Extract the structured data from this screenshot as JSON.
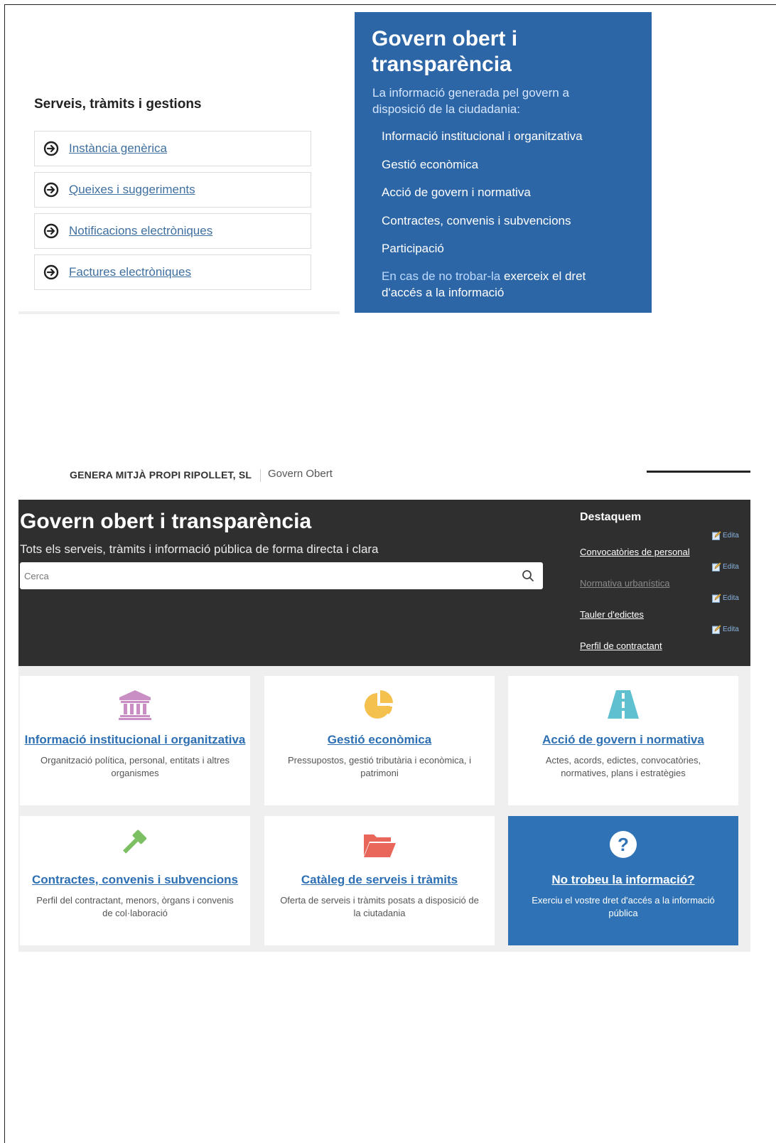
{
  "serveis": {
    "title": "Serveis, tràmits i gestions",
    "items": [
      {
        "label": "Instància genèrica"
      },
      {
        "label": "Queixes i suggeriments"
      },
      {
        "label": "Notificacions electròniques"
      },
      {
        "label": "Factures electròniques"
      }
    ]
  },
  "govern_panel": {
    "title": "Govern obert i transparència",
    "intro": "La informació generada pel govern a disposició de la ciudadania:",
    "links": [
      "Informació institucional i organitzativa",
      "Gestió econòmica",
      "Acció de govern i normativa",
      "Contractes, convenis i subvencions",
      "Participació"
    ],
    "last_link_part1": "En cas de no trobar-la",
    "last_link_part2": " exerceix el dret d'accés a la informació"
  },
  "brand": {
    "name": "GENERA MITJÀ PROPI RIPOLLET, SL",
    "subtitle": "Govern Obert"
  },
  "hero": {
    "title": "Govern obert i transparència",
    "subtitle": "Tots els serveis, tràmits i informació pública de forma directa i clara",
    "search_placeholder": "Cerca"
  },
  "destaquem": {
    "title": "Destaquem",
    "edit_label": "Edita",
    "links": [
      {
        "label": "Convocatòries de personal",
        "dimmed": false
      },
      {
        "label": "Normativa urbanística",
        "dimmed": true
      },
      {
        "label": "Tauler d'edictes",
        "dimmed": false
      },
      {
        "label": "Perfil de contractant",
        "dimmed": false
      }
    ]
  },
  "cards": [
    {
      "title": "Informació institucional i organitzativa",
      "desc": "Organització política, personal, entitats i altres organismes",
      "icon": "institution-icon",
      "color": "#c98fc4"
    },
    {
      "title": "Gestió econòmica",
      "desc": "Pressupostos, gestió tributària i econòmica, i patrimoni",
      "icon": "pie-chart-icon",
      "color": "#f4c04e"
    },
    {
      "title": "Acció de govern i normativa",
      "desc": "Actes, acords, edictes, convocatòries, normatives, plans i estratègies",
      "icon": "road-icon",
      "color": "#5fc0cf"
    },
    {
      "title": "Contractes, convenis i subvencions",
      "desc": "Perfil del contractant, menors, òrgans i convenis de col·laboració",
      "icon": "gavel-icon",
      "color": "#7cc063"
    },
    {
      "title": "Catàleg de serveis i tràmits",
      "desc": "Oferta de serveis i tràmits posats a disposició de la ciutadania",
      "icon": "folder-open-icon",
      "color": "#e8675a"
    },
    {
      "title": "No trobeu la informació?",
      "desc": "Exerciu el vostre dret d'accés a la informació pública",
      "icon": "question-circle-icon",
      "color": "#ffffff"
    }
  ]
}
